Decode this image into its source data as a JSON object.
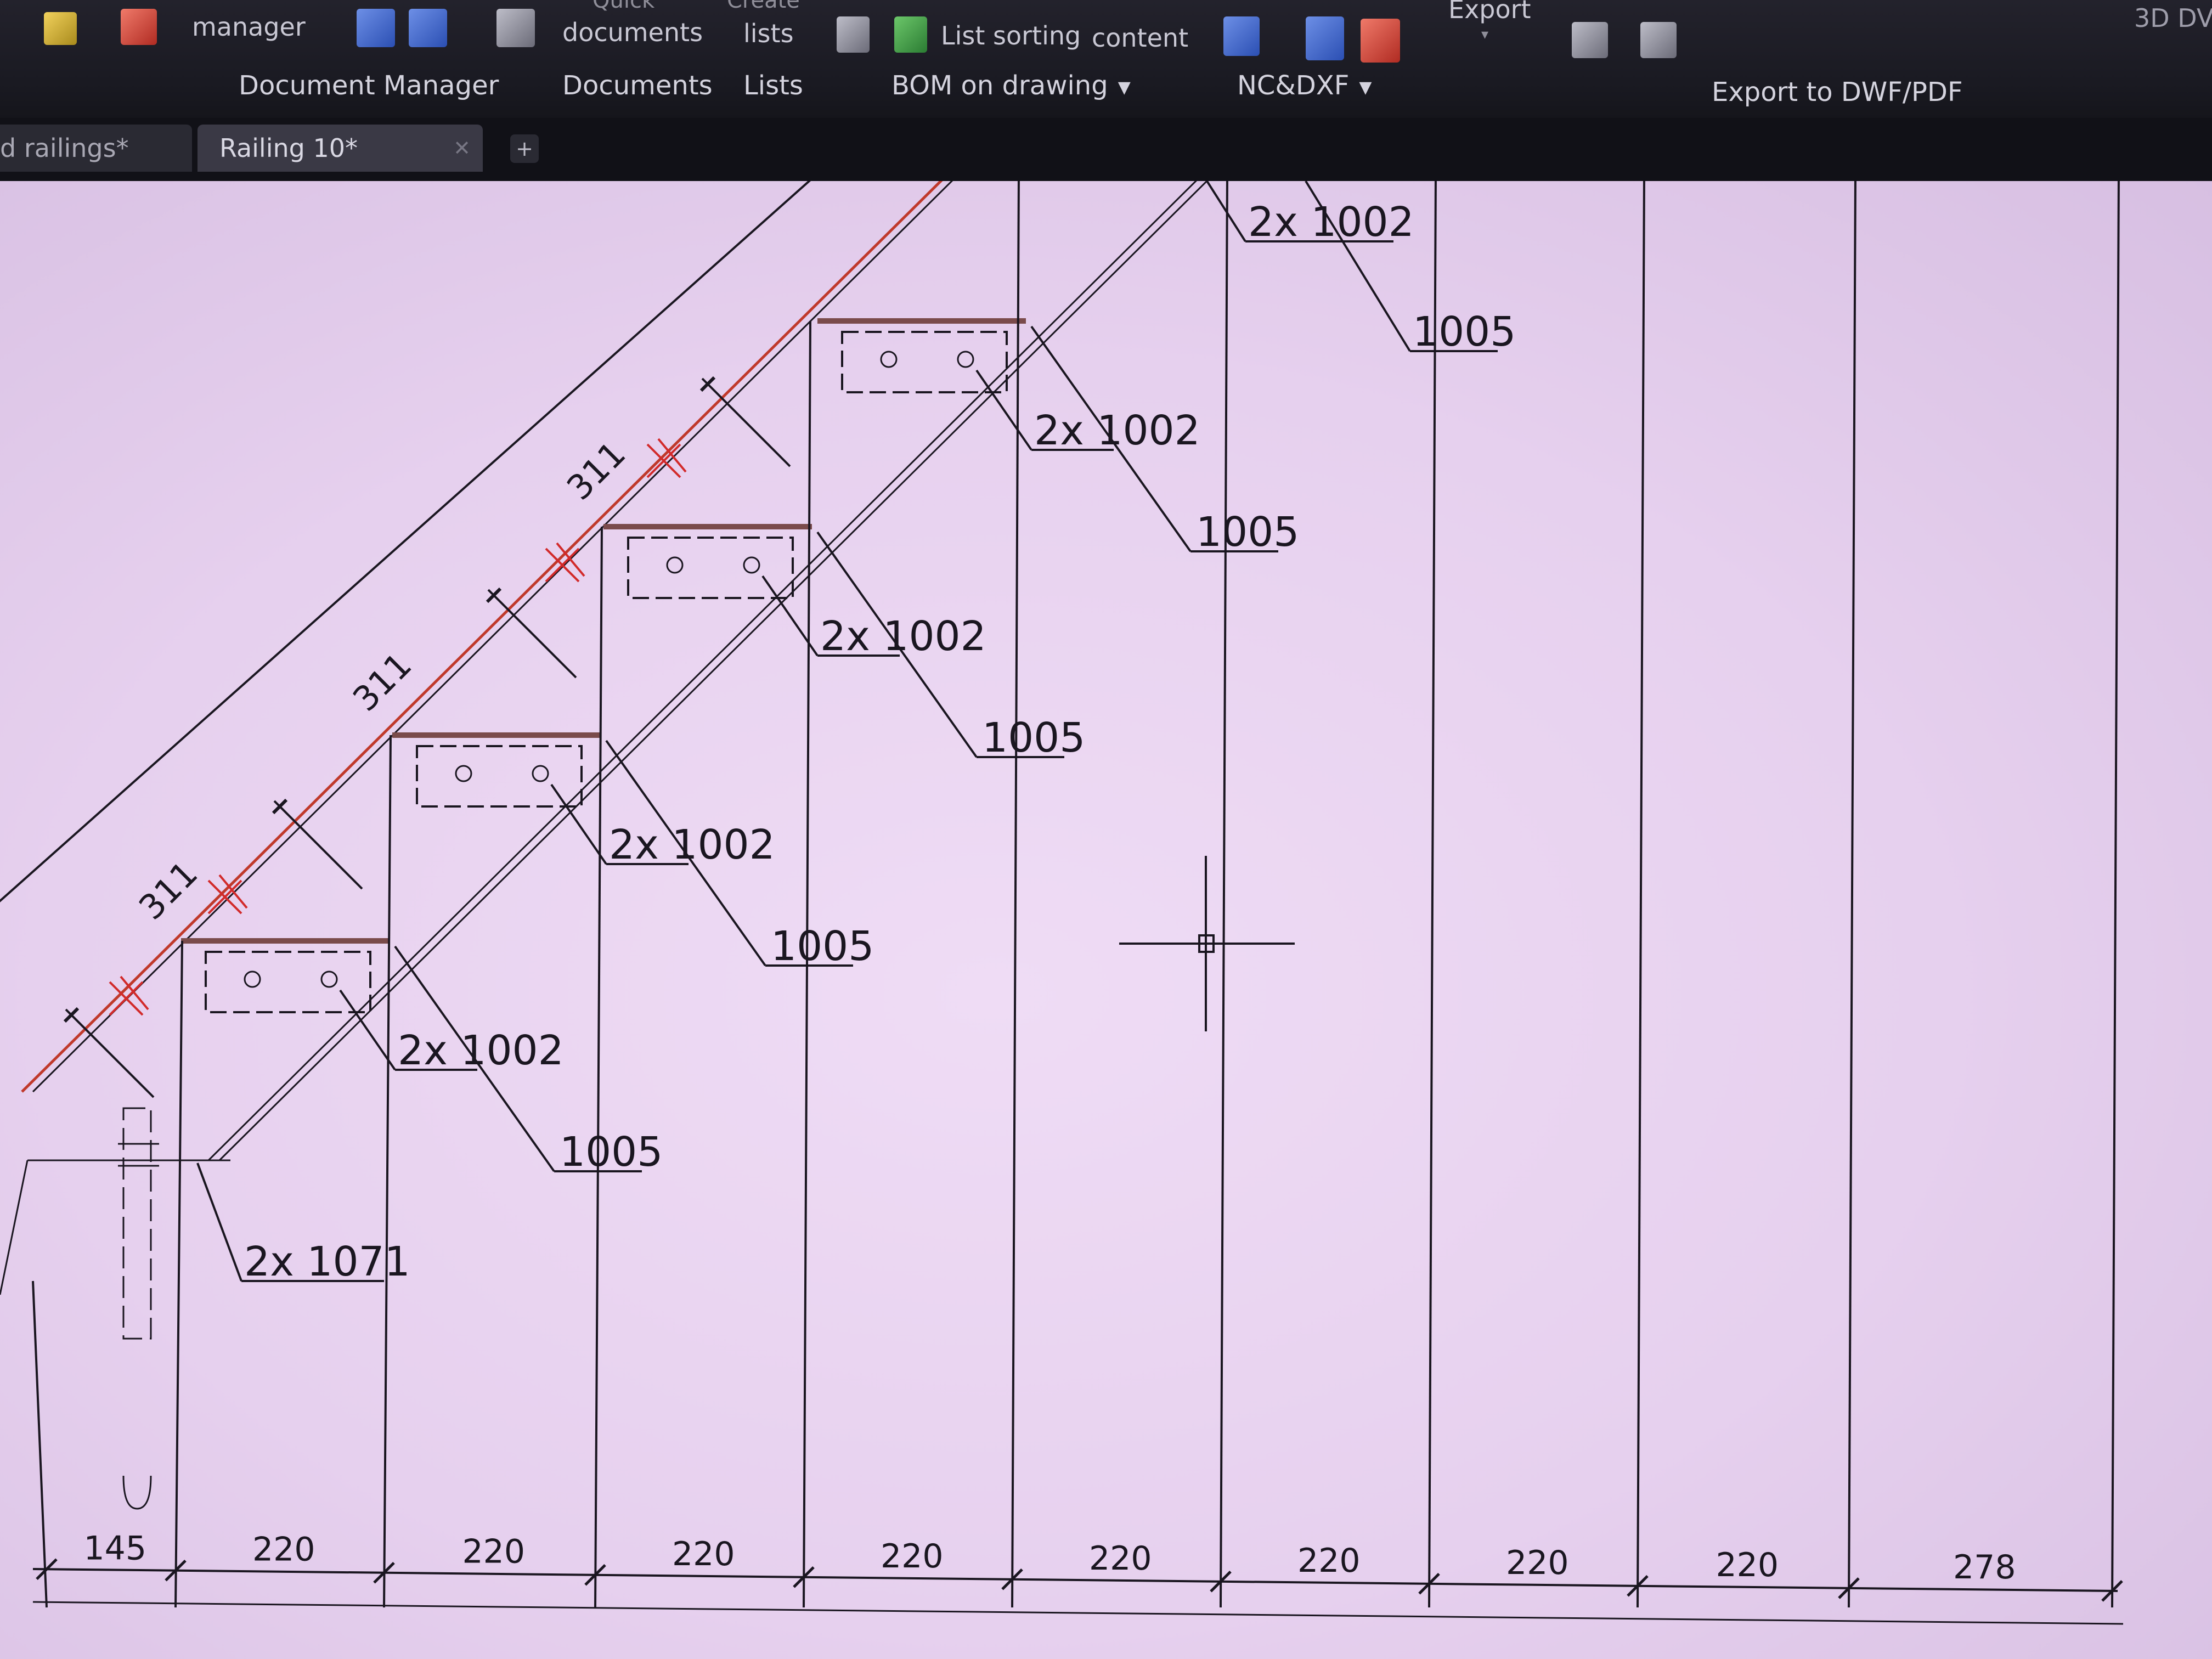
{
  "ribbon": {
    "manager_label": "manager",
    "documents_label": "documents",
    "documents_overline": "Quick",
    "lists_label": "lists",
    "lists_overline": "Create",
    "list_sorting": "List sorting",
    "content": "content",
    "export_label": "Export",
    "view_3d": "3D DV",
    "groups": {
      "document_manager": "Document Manager",
      "documents": "Documents",
      "lists": "Lists",
      "bom_on_drawing": "BOM on drawing",
      "nc_dxf": "NC&DXF",
      "export_dwf_pdf": "Export to DWF/PDF"
    }
  },
  "tabs": [
    {
      "label": "d railings*"
    },
    {
      "label": "Railing 10*"
    }
  ],
  "new_tab_label": "+",
  "drawing": {
    "stair_dims": [
      "311",
      "311",
      "311"
    ],
    "labels": {
      "bracket": "2x 1002",
      "plate": "1005",
      "base_bracket": "2x 1071"
    },
    "bottom_dims": [
      "145",
      "220",
      "220",
      "220",
      "220",
      "220",
      "220",
      "220",
      "220",
      "278"
    ]
  },
  "colors": {
    "canvas_bg": "#e8d3ef",
    "line": "#1a1620",
    "handrail_red": "#c0392b",
    "cross_red": "#d22a2a"
  }
}
